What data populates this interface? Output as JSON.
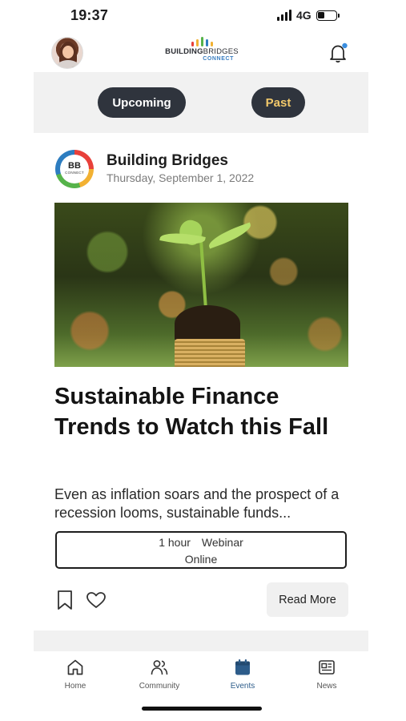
{
  "status_bar": {
    "time": "19:37",
    "network": "4G",
    "battery_level": 0.35
  },
  "header": {
    "logo": {
      "text_bold": "BUILDING",
      "text_light": "BRIDGES",
      "subtext": "CONNECT",
      "bar_colors": [
        "#e8403a",
        "#f2b132",
        "#56b34a",
        "#2d7dc0",
        "#f2b132"
      ]
    },
    "avatar_icon": "avatar",
    "notification_icon": "bell-icon"
  },
  "toggle": {
    "upcoming_label": "Upcoming",
    "past_label": "Past",
    "accent_color": "#f2c96b",
    "pill_color": "#2f343d"
  },
  "event": {
    "org_logo_text": "BB",
    "org_logo_subtext": "CONNECT",
    "org_name": "Building Bridges",
    "date": "Thursday, September 1, 2022",
    "title": "Sustainable Finance Trends to Watch this Fall",
    "description": "Even as inflation soars and the prospect of a recession looms, sustainable funds...",
    "duration": "1 hour",
    "type": "Webinar",
    "location": "Online",
    "read_more_label": "Read More"
  },
  "tabs": [
    {
      "label": "Home",
      "icon": "home-icon",
      "active": false
    },
    {
      "label": "Community",
      "icon": "community-icon",
      "active": false
    },
    {
      "label": "Events",
      "icon": "calendar-icon",
      "active": true
    },
    {
      "label": "News",
      "icon": "newspaper-icon",
      "active": false
    }
  ],
  "colors": {
    "active_tab": "#2d5c8a"
  }
}
